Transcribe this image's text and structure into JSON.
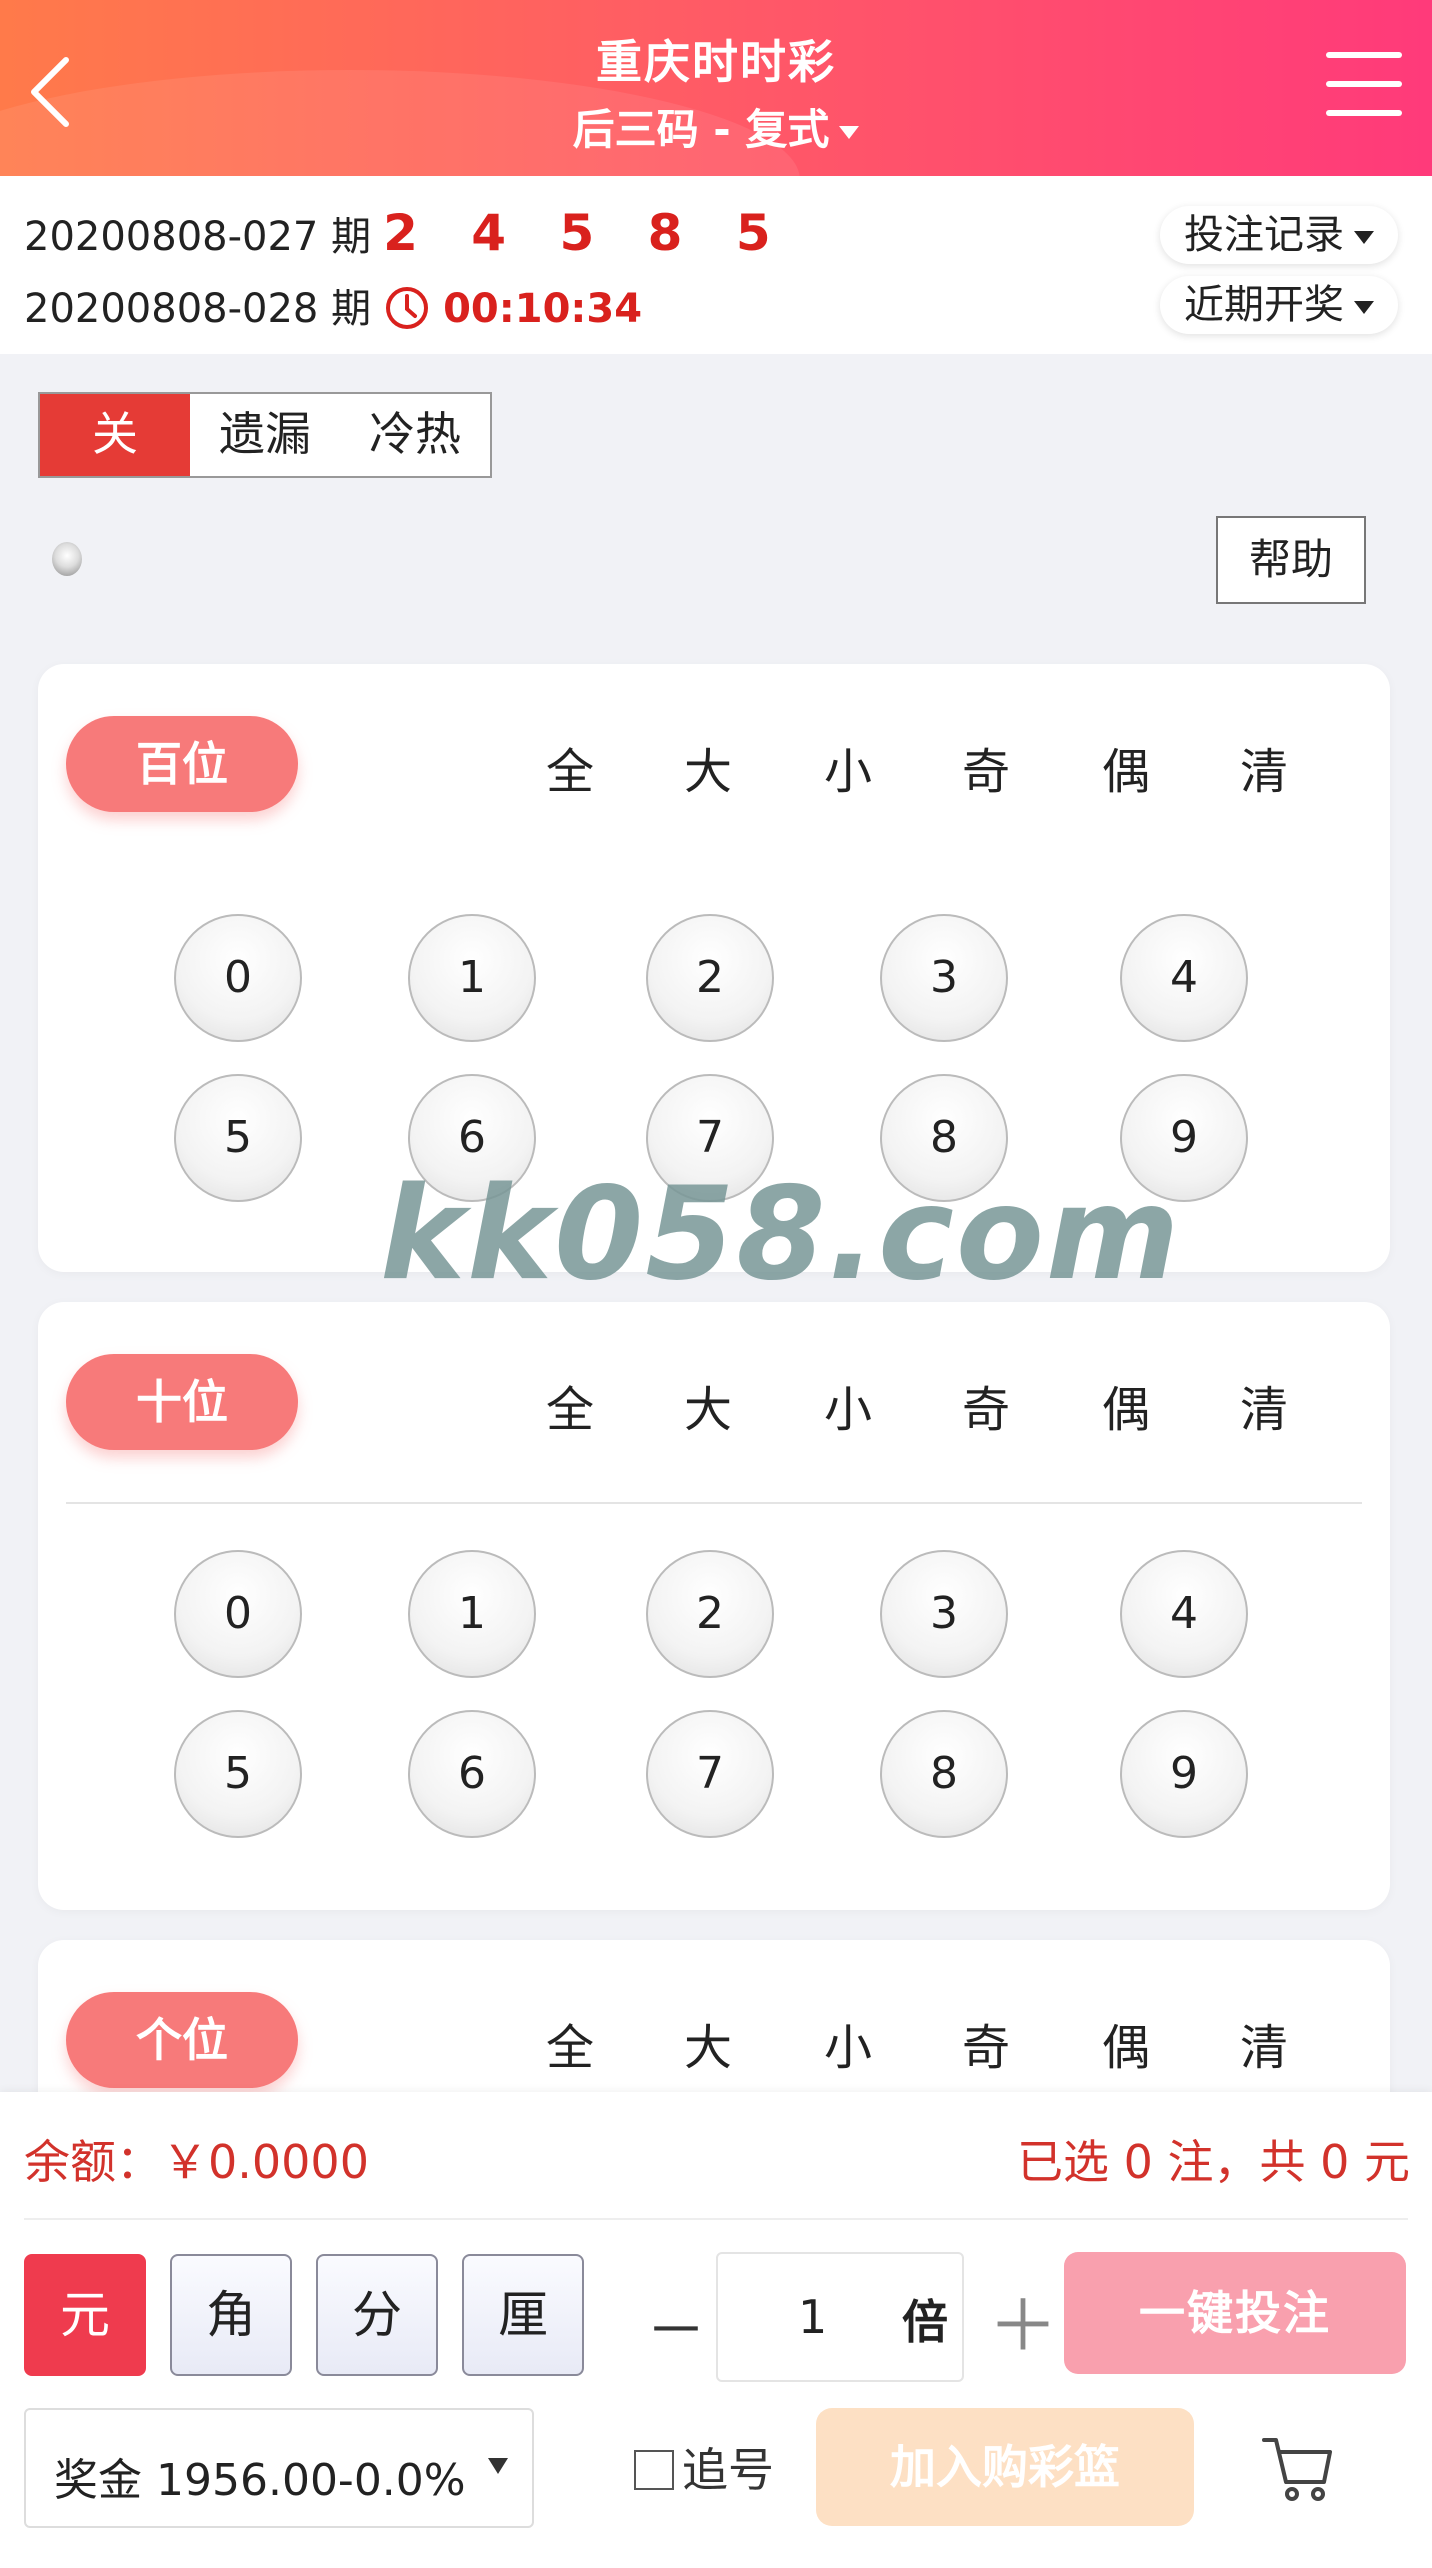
{
  "header": {
    "title": "重庆时时彩",
    "subtitle": "后三码 - 复式"
  },
  "issue": {
    "prev_label": "20200808-027 期",
    "prev_balls": "2 4 5 8 5",
    "next_label": "20200808-028 期",
    "countdown": "00:10:34",
    "bet_record": "投注记录",
    "recent_draws": "近期开奖"
  },
  "toggle": {
    "off": "关",
    "miss": "遗漏",
    "hot": "冷热"
  },
  "help": "帮助",
  "quick_labels": [
    "全",
    "大",
    "小",
    "奇",
    "偶",
    "清"
  ],
  "positions": [
    {
      "name": "百位",
      "digits": [
        "0",
        "1",
        "2",
        "3",
        "4",
        "5",
        "6",
        "7",
        "8",
        "9"
      ]
    },
    {
      "name": "十位",
      "digits": [
        "0",
        "1",
        "2",
        "3",
        "4",
        "5",
        "6",
        "7",
        "8",
        "9"
      ]
    },
    {
      "name": "个位"
    }
  ],
  "watermark": "kk058.com",
  "footer": {
    "balance": "余额：￥0.0000",
    "selected": "已选 0 注，共 0 元",
    "units": [
      "元",
      "角",
      "分",
      "厘"
    ],
    "minus": "－",
    "multiplier": "1",
    "multiplier_unit": "倍",
    "plus": "＋",
    "bet_button": "一键投注",
    "prize": "奖金 1956.00-0.0%",
    "chase": "追号",
    "add_cart": "加入购彩篮"
  },
  "colors": {
    "header_start": "#ff7a4a",
    "header_end": "#ff3a7a",
    "accent_red": "#d9211d",
    "pill": "#f77a7a"
  }
}
